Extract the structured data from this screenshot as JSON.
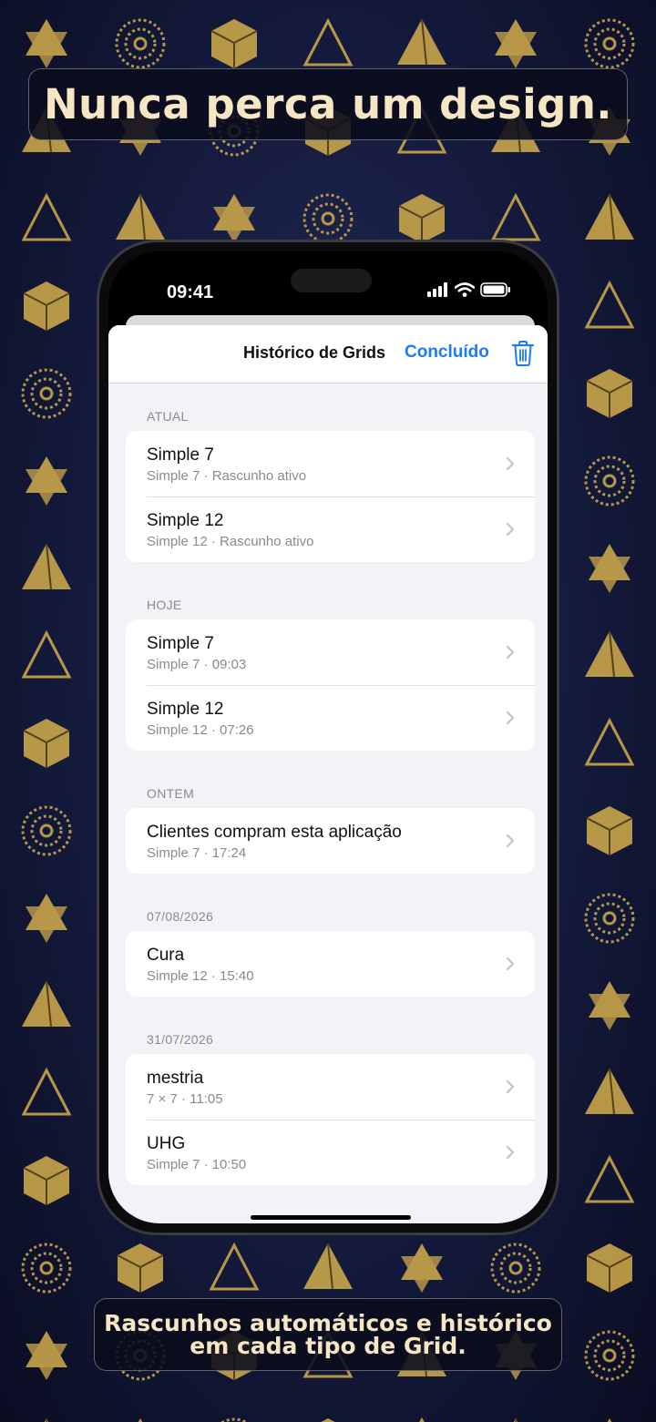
{
  "headline": "Nunca perca um design.",
  "caption": {
    "line1": "Rascunhos automáticos e histórico",
    "line2": "em cada tipo de Grid."
  },
  "status_bar": {
    "time": "09:41",
    "icons": [
      "cellular-signal-icon",
      "wifi-icon",
      "battery-icon"
    ]
  },
  "nav": {
    "title": "Histórico de Grids",
    "done_label": "Concluído",
    "trash_icon": "trash-icon"
  },
  "sections": [
    {
      "header": "ATUAL",
      "rows": [
        {
          "title": "Simple 7",
          "subtitle": "Simple 7 · Rascunho ativo"
        },
        {
          "title": "Simple 12",
          "subtitle": "Simple 12 · Rascunho ativo"
        }
      ]
    },
    {
      "header": "HOJE",
      "rows": [
        {
          "title": "Simple 7",
          "subtitle": "Simple 7 · 09:03"
        },
        {
          "title": "Simple 12",
          "subtitle": "Simple 12 · 07:26"
        }
      ]
    },
    {
      "header": "ONTEM",
      "rows": [
        {
          "title": "Clientes compram esta aplicação",
          "subtitle": "Simple 7 · 17:24"
        }
      ]
    },
    {
      "header": "07/08/2026",
      "rows": [
        {
          "title": "Cura",
          "subtitle": "Simple 12 · 15:40"
        }
      ]
    },
    {
      "header": "31/07/2026",
      "rows": [
        {
          "title": "mestria",
          "subtitle": "7 × 7 · 11:05"
        },
        {
          "title": "UHG",
          "subtitle": "Simple 7 · 10:50"
        }
      ]
    }
  ],
  "colors": {
    "accent": "#1d7cf2",
    "headline_text": "#f6e6c4",
    "pattern_gold": "#c9a54a",
    "background": "#141a3c"
  }
}
